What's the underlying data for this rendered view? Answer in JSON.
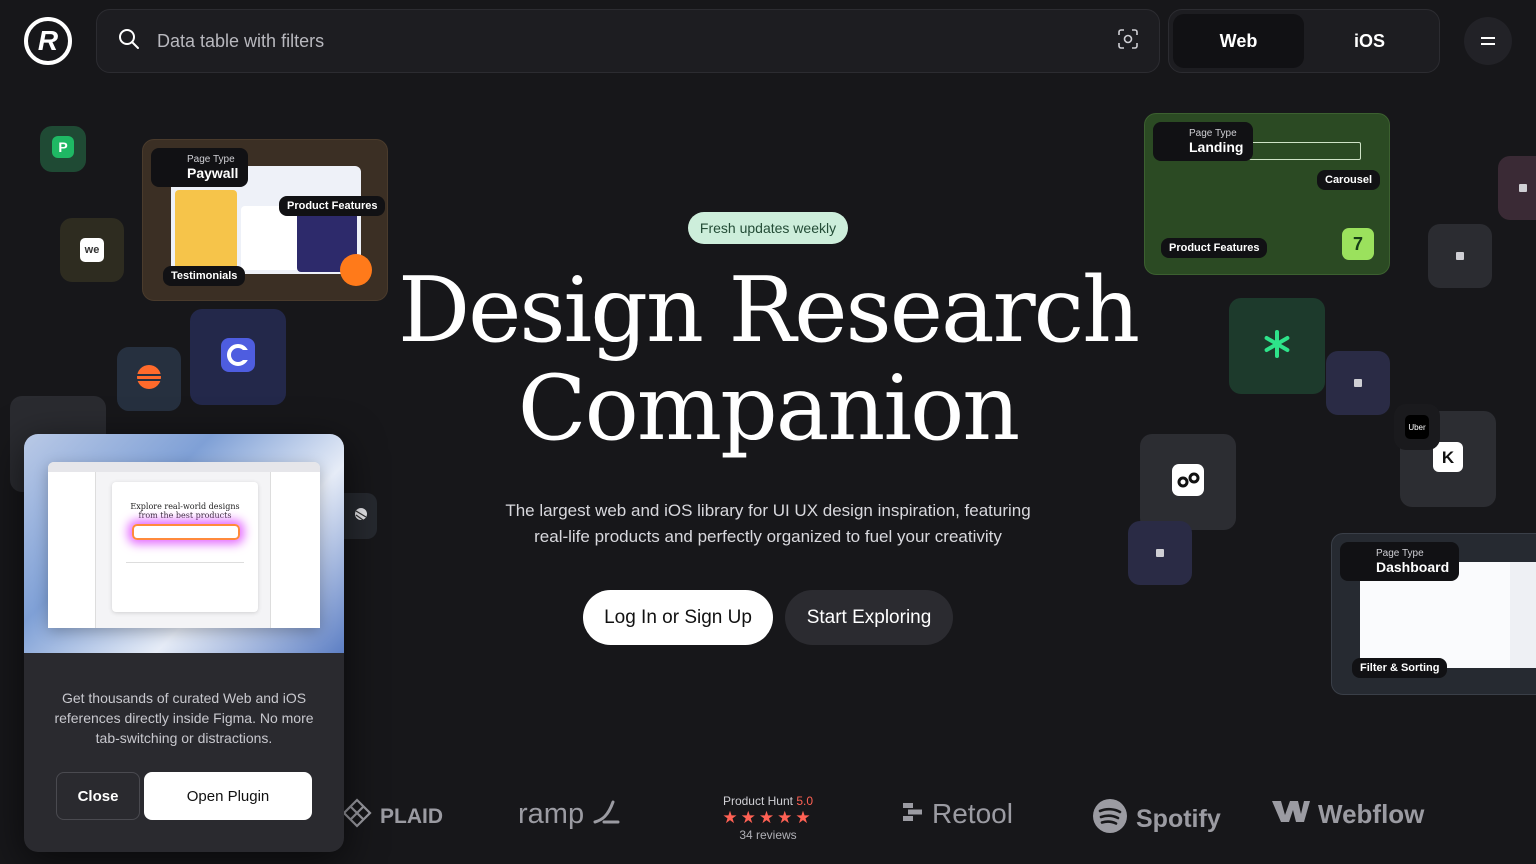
{
  "header": {
    "logo_letter": "R",
    "search": {
      "placeholder": "Data table with filters"
    },
    "platforms": [
      {
        "label": "Web",
        "active": true
      },
      {
        "label": "iOS",
        "active": false
      }
    ]
  },
  "hero": {
    "badge": "Fresh updates weekly",
    "title_line1": "Design Research",
    "title_line2": "Companion",
    "subtitle_line1": "The largest web and iOS library for UI UX design inspiration, featuring",
    "subtitle_line2": "real-life products and perfectly organized to fuel your creativity",
    "cta_primary": "Log In or Sign Up",
    "cta_secondary": "Start Exploring"
  },
  "cards": {
    "paywall": {
      "key": "Page Type",
      "value": "Paywall",
      "chip1": "Product Features",
      "chip2": "Testimonials"
    },
    "landing": {
      "key": "Page Type",
      "value": "Landing",
      "chip1": "Carousel",
      "chip2": "Product Features"
    },
    "dashboard": {
      "key": "Page Type",
      "value": "Dashboard",
      "chip1": "Filter & Sorting"
    }
  },
  "tile_labels": {
    "we": "we",
    "uber": "Uber"
  },
  "preview": {
    "heading_line1": "Explore real-world designs",
    "heading_line2": "from the best products"
  },
  "popup": {
    "text": "Get thousands of curated Web and iOS references directly inside Figma. No more tab-switching or distractions.",
    "close": "Close",
    "open": "Open Plugin"
  },
  "brands": {
    "plaid": "PLAID",
    "ramp": "ramp",
    "retool": "Retool",
    "spotify": "Spotify",
    "webflow": "Webflow",
    "producthunt": {
      "label": "Product Hunt",
      "score": "5.0",
      "reviews": "34 reviews",
      "stars": "★★★★★"
    }
  },
  "colors": {
    "background": "#17171a",
    "badge_bg": "#cdeedb",
    "producthunt": "#ff6154"
  }
}
